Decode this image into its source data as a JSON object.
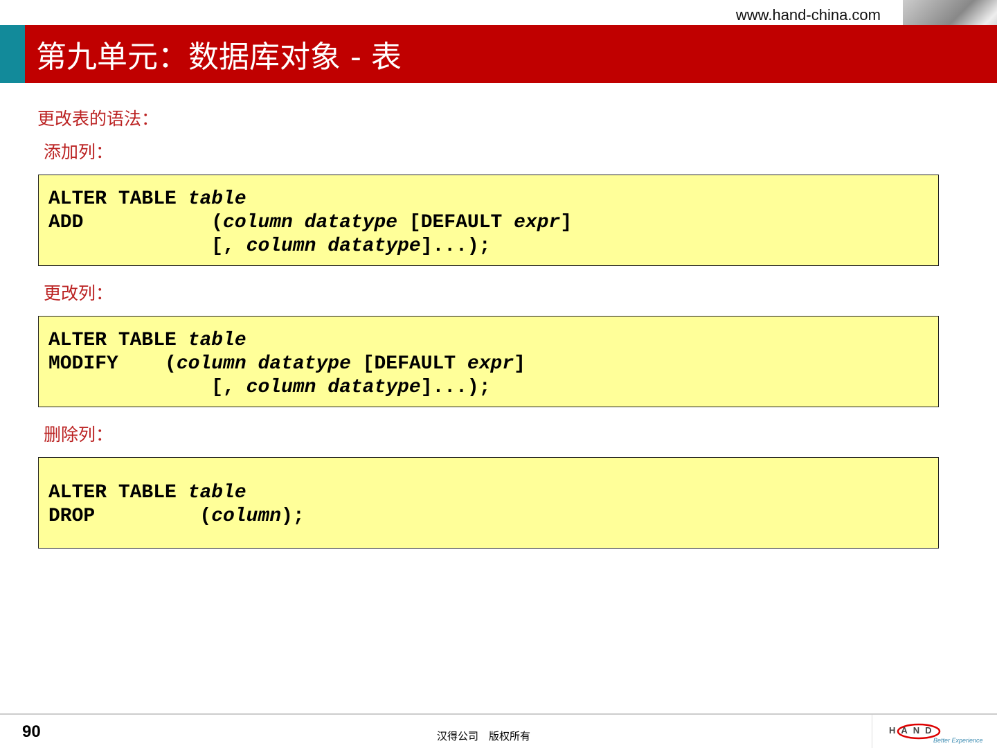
{
  "header": {
    "url": "www.hand-china.com",
    "title": "第九单元：数据库对象 - 表"
  },
  "intro": "更改表的语法：",
  "sections": [
    {
      "label": "添加列：",
      "lines": [
        [
          [
            "ALTER TABLE ",
            false
          ],
          [
            "table",
            true
          ]
        ],
        [
          [
            "ADD           (",
            false
          ],
          [
            "column datatype",
            true
          ],
          [
            " [DEFAULT ",
            false
          ],
          [
            "expr",
            true
          ],
          [
            "]",
            false
          ]
        ],
        [
          [
            "              [, ",
            false
          ],
          [
            "column datatype",
            true
          ],
          [
            "]...);",
            false
          ]
        ]
      ]
    },
    {
      "label": "更改列：",
      "lines": [
        [
          [
            "ALTER TABLE ",
            false
          ],
          [
            "table",
            true
          ]
        ],
        [
          [
            "MODIFY    (",
            false
          ],
          [
            "column datatype",
            true
          ],
          [
            " [DEFAULT ",
            false
          ],
          [
            "expr",
            true
          ],
          [
            "]",
            false
          ]
        ],
        [
          [
            "              [, ",
            false
          ],
          [
            "column datatype",
            true
          ],
          [
            "]...);",
            false
          ]
        ]
      ]
    },
    {
      "label": "删除列：",
      "lines": [
        [
          [
            "ALTER TABLE ",
            false
          ],
          [
            "table",
            true
          ]
        ],
        [
          [
            "DROP         (",
            false
          ],
          [
            "column",
            true
          ],
          [
            ");",
            false
          ]
        ]
      ]
    }
  ],
  "footer": {
    "page": "90",
    "copyright": "汉得公司　版权所有",
    "logo_text": "HAND",
    "logo_tagline": "Better Experience"
  }
}
